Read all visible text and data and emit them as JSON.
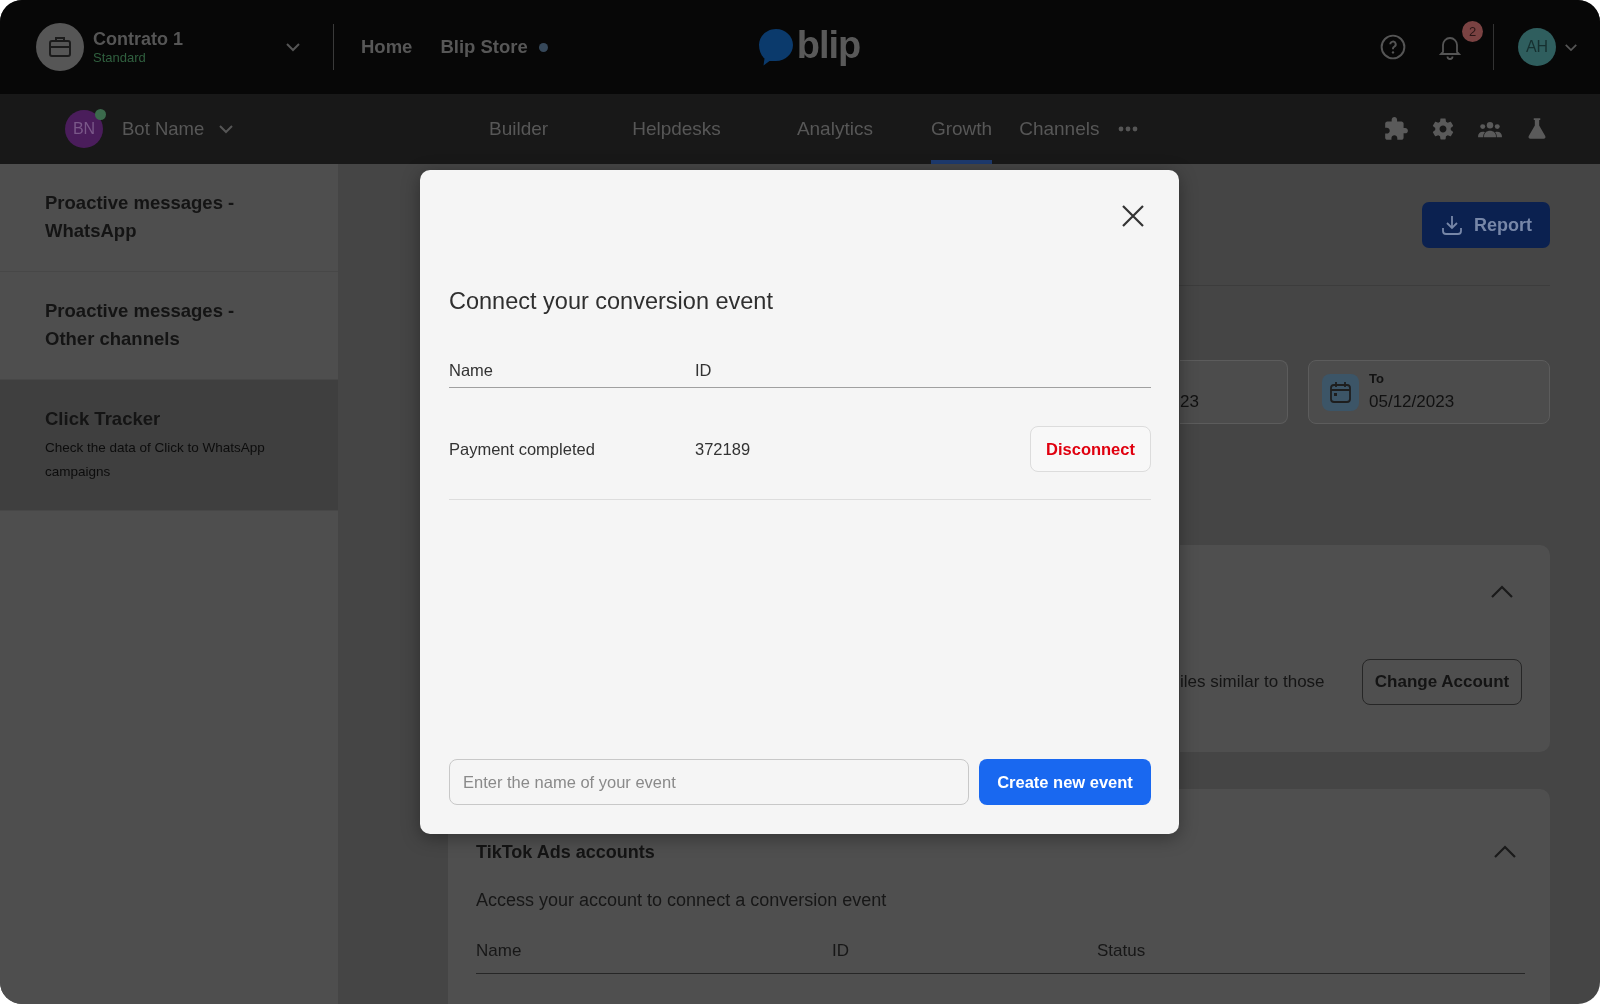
{
  "top_bar": {
    "contract": {
      "name": "Contrato 1",
      "plan": "Standard"
    },
    "links": [
      {
        "label": "Home",
        "dot": false
      },
      {
        "label": "Blip Store",
        "dot": true
      }
    ],
    "logo": {
      "text": "blip"
    },
    "notifications": {
      "count": "2"
    },
    "user": {
      "initials": "AH"
    }
  },
  "nav_bar": {
    "bot": {
      "initials": "BN",
      "name": "Bot Name",
      "online": true
    },
    "tabs": [
      {
        "label": "Builder",
        "selected": false
      },
      {
        "label": "Helpdesks",
        "selected": false
      },
      {
        "label": "Analytics",
        "selected": false
      },
      {
        "label": "Growth",
        "selected": true
      },
      {
        "label": "Channels",
        "selected": false
      }
    ]
  },
  "sidebar": {
    "items": [
      {
        "title": "Proactive messages - WhatsApp",
        "selected": false
      },
      {
        "title": "Proactive messages - Other channels",
        "selected": false
      },
      {
        "title": "Click Tracker",
        "description": "Check the data of Click to WhatsApp campaigns",
        "selected": true
      }
    ]
  },
  "main": {
    "report_button": "Report",
    "date_from": {
      "value": "23"
    },
    "date_to": {
      "label": "To",
      "value": "05/12/2023"
    },
    "cards": [
      {
        "kind": "account",
        "text": "iles similar to those",
        "button": "Change Account",
        "expanded": true
      },
      {
        "kind": "table",
        "title": "TikTok Ads accounts",
        "description": "Access your account to connect a conversion event",
        "columns": [
          "Name",
          "ID",
          "Status"
        ],
        "expanded": true
      }
    ]
  },
  "modal": {
    "title": "Connect your conversion event",
    "columns": [
      "Name",
      "ID"
    ],
    "rows": [
      {
        "name": "Payment completed",
        "id": "372189",
        "action": "Disconnect"
      }
    ],
    "input": {
      "placeholder": "Enter the name of your event"
    },
    "create_button": "Create new event"
  }
}
